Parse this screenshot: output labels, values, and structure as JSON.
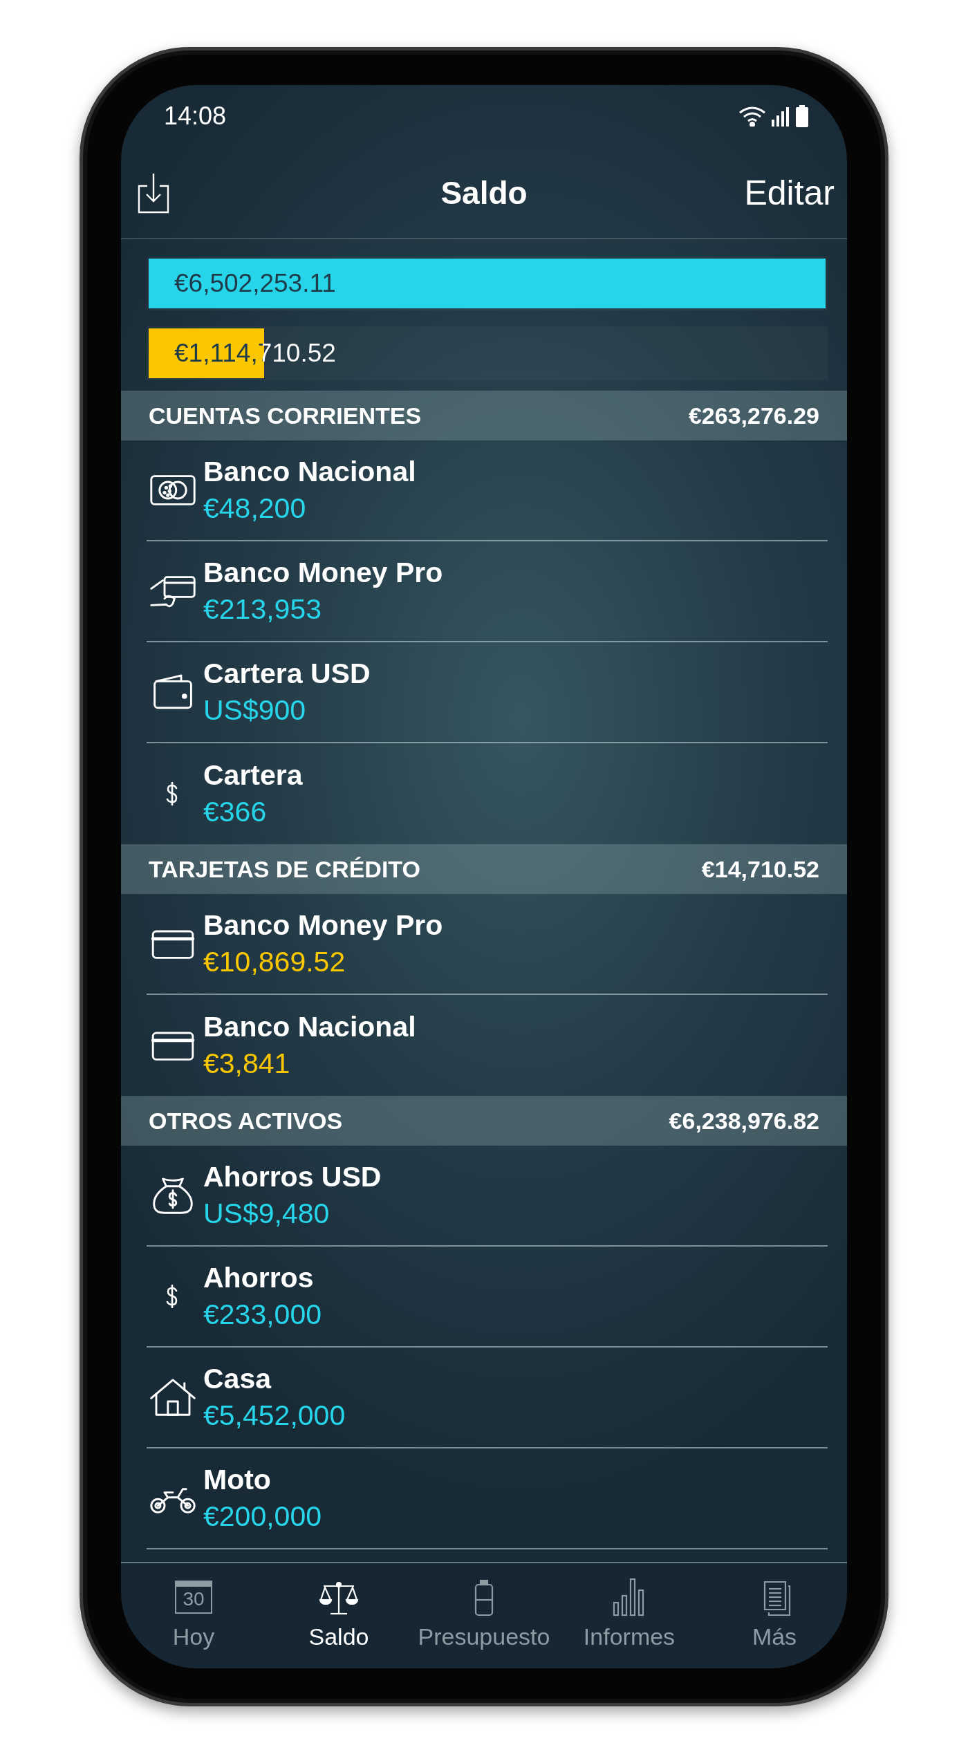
{
  "status_bar": {
    "time": "14:08"
  },
  "header": {
    "title": "Saldo",
    "action": "Editar"
  },
  "balance_bars": [
    {
      "amount": "€6,502,253.11",
      "level": 1.0,
      "color": "#27d5eb"
    },
    {
      "amount": "€1,114,710.52",
      "level": 0.171,
      "color": "#fbc800"
    }
  ],
  "sections": [
    {
      "title": "CUENTAS CORRIENTES",
      "total": "€263,276.29",
      "accounts": [
        {
          "name": "Banco Nacional",
          "amount": "€48,200",
          "kind": "card-coins",
          "color": "#27d5eb"
        },
        {
          "name": "Banco Money Pro",
          "amount": "€213,953",
          "kind": "hand-card",
          "color": "#27d5eb"
        },
        {
          "name": "Cartera USD",
          "amount": "US$900",
          "kind": "wallet",
          "color": "#27d5eb"
        },
        {
          "name": "Cartera",
          "amount": "€366",
          "kind": "dollar",
          "color": "#27d5eb"
        }
      ]
    },
    {
      "title": "TARJETAS DE CRÉDITO",
      "total": "€14,710.52",
      "accounts": [
        {
          "name": "Banco Money Pro",
          "amount": "€10,869.52",
          "kind": "credit-card",
          "color": "#fbc800"
        },
        {
          "name": "Banco Nacional",
          "amount": "€3,841",
          "kind": "credit-card",
          "color": "#fbc800"
        }
      ]
    },
    {
      "title": "OTROS ACTIVOS",
      "total": "€6,238,976.82",
      "accounts": [
        {
          "name": "Ahorros USD",
          "amount": "US$9,480",
          "kind": "money-bag",
          "color": "#27d5eb"
        },
        {
          "name": "Ahorros",
          "amount": "€233,000",
          "kind": "dollar",
          "color": "#27d5eb"
        },
        {
          "name": "Casa",
          "amount": "€5,452,000",
          "kind": "house",
          "color": "#27d5eb"
        },
        {
          "name": "Moto",
          "amount": "€200,000",
          "kind": "motorcycle",
          "color": "#27d5eb"
        }
      ]
    }
  ],
  "tab_bar": [
    {
      "label": "Hoy",
      "kind": "calendar",
      "calendar_day": "30",
      "selected": false
    },
    {
      "label": "Saldo",
      "kind": "scale",
      "selected": true
    },
    {
      "label": "Presupuesto",
      "kind": "battery",
      "selected": false
    },
    {
      "label": "Informes",
      "kind": "bars",
      "selected": false
    },
    {
      "label": "Más",
      "kind": "documents",
      "selected": false
    }
  ]
}
